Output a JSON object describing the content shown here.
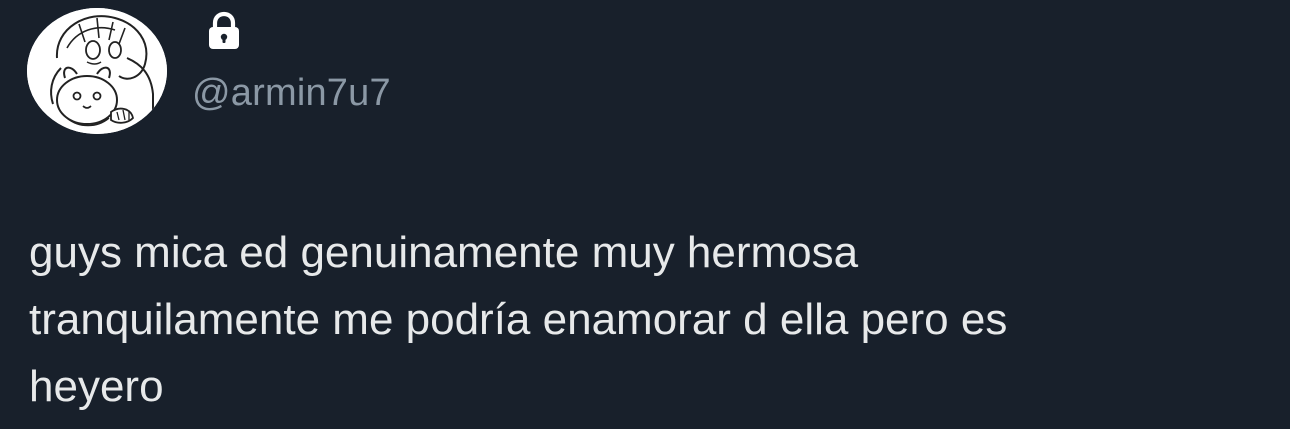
{
  "author": {
    "avatar_icon": "anime-character-avatar",
    "protected_icon": "lock-icon",
    "handle": "@armin7u7"
  },
  "tweet": {
    "lines": [
      "guys mica ed genuinamente muy hermosa",
      "tranquilamente me podría enamorar d ella pero es",
      "heyero"
    ]
  },
  "colors": {
    "background": "#18202b",
    "text": "#e7e9ea",
    "handle": "#8b98a5"
  }
}
